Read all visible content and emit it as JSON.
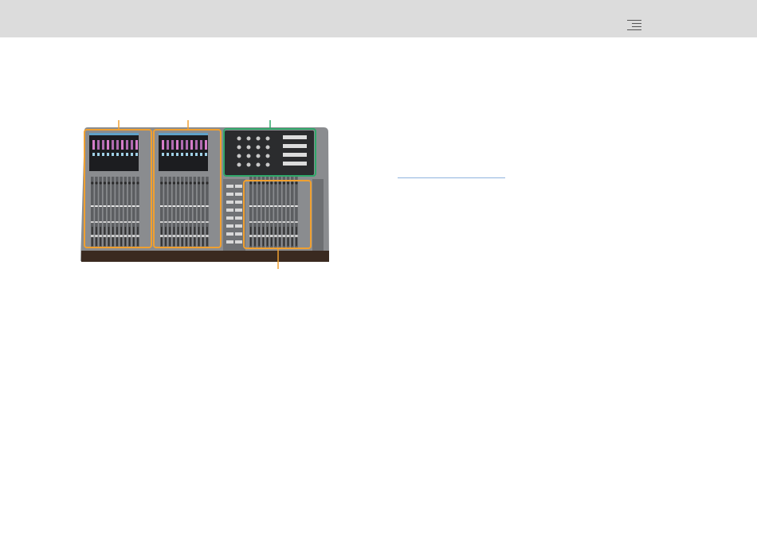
{
  "header": {
    "menu_icon": "menu-icon",
    "background": "#dcdcdc"
  },
  "figure": {
    "subject": "mixing-console-illustration",
    "callout_colors": {
      "fader_bay": "#f0a030",
      "selected_channel_section": "#2fa86a"
    }
  },
  "link": {
    "color": "#8fb4de"
  }
}
